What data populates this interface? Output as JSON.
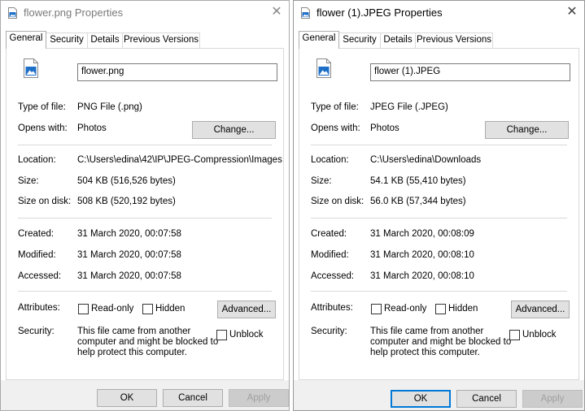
{
  "left": {
    "title": "flower.png Properties",
    "tabs": [
      {
        "label": "General"
      },
      {
        "label": "Security"
      },
      {
        "label": "Details"
      },
      {
        "label": "Previous Versions"
      }
    ],
    "filename": "flower.png",
    "type_label": "Type of file:",
    "type_value": "PNG File (.png)",
    "opens_label": "Opens with:",
    "opens_value": "Photos",
    "change_label": "Change...",
    "location_label": "Location:",
    "location_value": "C:\\Users\\edina\\42\\IP\\JPEG-Compression\\Images",
    "size_label": "Size:",
    "size_value": "504 KB (516,526 bytes)",
    "size_disk_label": "Size on disk:",
    "size_disk_value": "508 KB (520,192 bytes)",
    "created_label": "Created:",
    "created_value": "31 March 2020, 00:07:58",
    "modified_label": "Modified:",
    "modified_value": "31 March 2020, 00:07:58",
    "accessed_label": "Accessed:",
    "accessed_value": "31 March 2020, 00:07:58",
    "attributes_label": "Attributes:",
    "readonly_label": "Read-only",
    "hidden_label": "Hidden",
    "advanced_label": "Advanced...",
    "security_label": "Security:",
    "security_line1": "This file came from another",
    "security_line2": "computer and might be blocked to",
    "security_line3": "help protect this computer.",
    "unblock_label": "Unblock",
    "ok_label": "OK",
    "cancel_label": "Cancel",
    "apply_label": "Apply"
  },
  "right": {
    "title": "flower (1).JPEG Properties",
    "tabs": [
      {
        "label": "General"
      },
      {
        "label": "Security"
      },
      {
        "label": "Details"
      },
      {
        "label": "Previous Versions"
      }
    ],
    "filename": "flower (1).JPEG",
    "type_label": "Type of file:",
    "type_value": "JPEG File (.JPEG)",
    "opens_label": "Opens with:",
    "opens_value": "Photos",
    "change_label": "Change...",
    "location_label": "Location:",
    "location_value": "C:\\Users\\edina\\Downloads",
    "size_label": "Size:",
    "size_value": "54.1 KB (55,410 bytes)",
    "size_disk_label": "Size on disk:",
    "size_disk_value": "56.0 KB (57,344 bytes)",
    "created_label": "Created:",
    "created_value": "31 March 2020, 00:08:09",
    "modified_label": "Modified:",
    "modified_value": "31 March 2020, 00:08:10",
    "accessed_label": "Accessed:",
    "accessed_value": "31 March 2020, 00:08:10",
    "attributes_label": "Attributes:",
    "readonly_label": "Read-only",
    "hidden_label": "Hidden",
    "advanced_label": "Advanced...",
    "security_label": "Security:",
    "security_line1": "This file came from another",
    "security_line2": "computer and might be blocked to",
    "security_line3": "help protect this computer.",
    "unblock_label": "Unblock",
    "ok_label": "OK",
    "cancel_label": "Cancel",
    "apply_label": "Apply"
  },
  "icons": {
    "file": "image-file-icon",
    "close": "close-icon"
  },
  "colors": {
    "accent": "#0078d7",
    "icon_blue": "#1e6fc8"
  }
}
